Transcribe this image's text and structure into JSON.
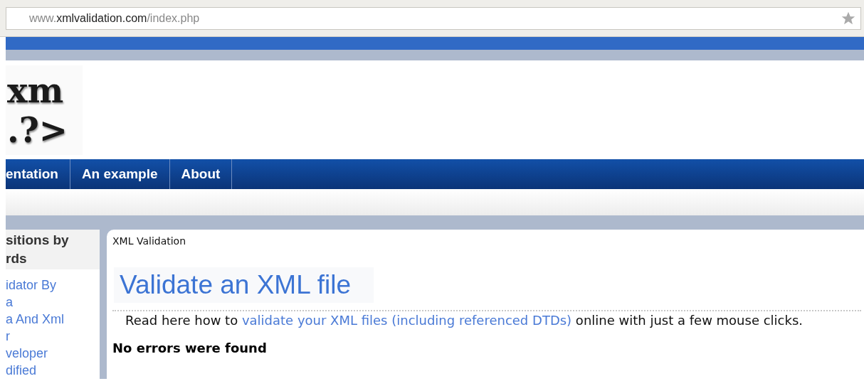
{
  "address_bar": {
    "prefix": "www.",
    "domain": "xmlvalidation.com",
    "path": "/index.php"
  },
  "logo": {
    "line_1": "xm",
    "line_2": ".?>"
  },
  "nav": [
    {
      "label": "entation",
      "selected": false
    },
    {
      "label": "An example",
      "selected": false
    },
    {
      "label": "About",
      "selected": false
    }
  ],
  "sidebar": {
    "heading": "sitions by\nrds",
    "links": [
      "idator By",
      "a",
      "a And Xml",
      "r",
      "veloper",
      "dified"
    ]
  },
  "content": {
    "breadcrumb": "XML Validation",
    "title": "Validate an XML file",
    "intro": {
      "before": "Read here how to ",
      "link": "validate your XML files (including referenced DTDs)",
      "after": " online with just a few mouse clicks."
    },
    "status": "No errors were found"
  }
}
